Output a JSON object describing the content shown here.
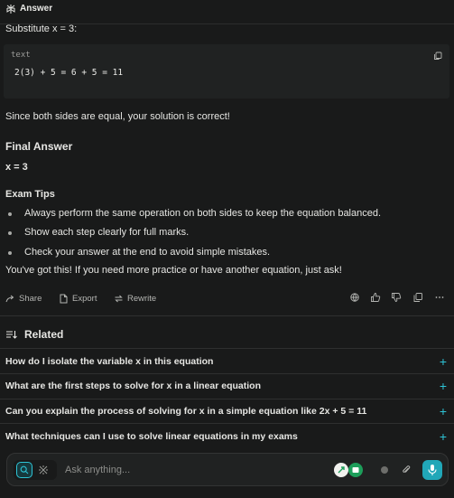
{
  "header": {
    "title": "Answer",
    "logo_icon": "perplexity-logo-icon"
  },
  "answer": {
    "substitute_line": "Substitute x = 3:",
    "code_block": {
      "lang": "text",
      "code": "2(3) + 5 = 6 + 5 = 11",
      "copy_icon": "copy-icon"
    },
    "verify_text": "Since both sides are equal, your solution is correct!",
    "final_heading": "Final Answer",
    "final_value": "x = 3",
    "tips_heading": "Exam Tips",
    "tips": [
      "Always perform the same operation on both sides to keep the equation balanced.",
      "Show each step clearly for full marks.",
      "Check your answer at the end to avoid simple mistakes."
    ],
    "closing": "You've got this! If you need more practice or have another equation, just ask!"
  },
  "actions": {
    "share": "Share",
    "export": "Export",
    "rewrite": "Rewrite",
    "right_icons": [
      "globe-icon",
      "thumbs-up-icon",
      "thumbs-down-icon",
      "copy-icon",
      "more-icon"
    ]
  },
  "related": {
    "heading": "Related",
    "items": [
      "How do I isolate the variable x in this equation",
      "What are the first steps to solve for x in a linear equation",
      "Can you explain the process of solving for x in a simple equation like 2x + 5 = 11",
      "What techniques can I use to solve linear equations in my exams"
    ]
  },
  "ask_bar": {
    "placeholder": "Ask anything..."
  },
  "colors": {
    "background": "#191a1a",
    "accent": "#2ec4d6",
    "code_bg": "#202222"
  }
}
